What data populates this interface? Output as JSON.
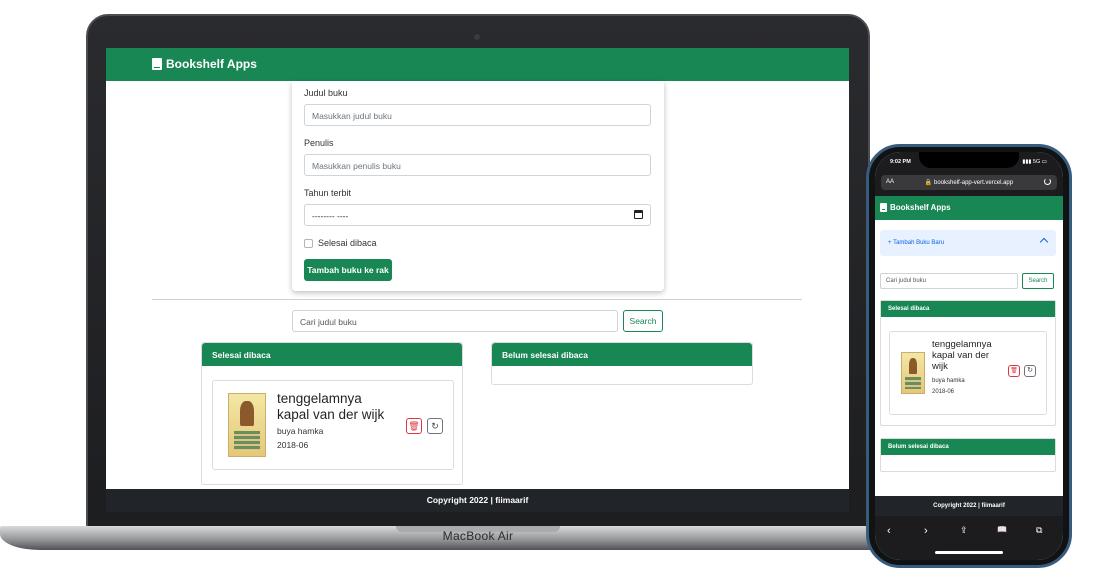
{
  "app": {
    "brand": "Bookshelf Apps",
    "footer": "Copyright 2022 | fiimaarif"
  },
  "form": {
    "title_label": "Judul buku",
    "title_placeholder": "Masukkan judul buku",
    "author_label": "Penulis",
    "author_placeholder": "Masukkan penulis buku",
    "year_label": "Tahun terbit",
    "year_value": "-------- ----",
    "finished_label": "Selesai dibaca",
    "submit_label": "Tambah buku ke rak"
  },
  "search": {
    "placeholder": "Cari judul buku",
    "button_label": "Search"
  },
  "shelves": {
    "finished_header": "Selesai dibaca",
    "unfinished_header": "Belum selesai dibaca"
  },
  "book": {
    "title": "tenggelamnya kapal van der wijk",
    "author": "buya hamka",
    "year": "2018-06"
  },
  "device": {
    "laptop_label": "MacBook Air",
    "phone_time": "9:02 PM",
    "phone_status": "▮▮▮ 5G ▭",
    "phone_text_size": "AA",
    "phone_url": "🔒 bookshelf-app-vert.vercel.app",
    "accordion_label": "+ Tambah Buku Baru",
    "toolbar": {
      "back": "‹",
      "forward": "›",
      "share": "⇪",
      "bookmarks": "📖",
      "tabs": "⧉"
    }
  }
}
